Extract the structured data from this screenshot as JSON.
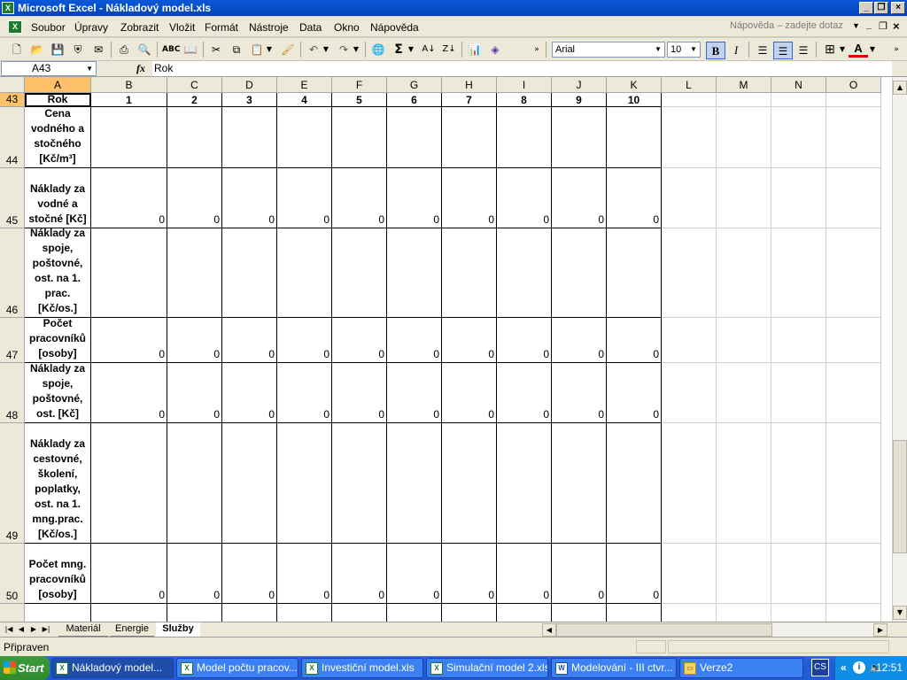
{
  "window": {
    "title": "Microsoft Excel - Nákladový model.xls"
  },
  "menu": {
    "items": [
      "Soubor",
      "Úpravy",
      "Zobrazit",
      "Vložit",
      "Formát",
      "Nástroje",
      "Data",
      "Okno",
      "Nápověda"
    ],
    "help_placeholder": "Nápověda – zadejte dotaz"
  },
  "toolbar": {
    "font_name": "Arial",
    "font_size": "10",
    "sigma": "Σ"
  },
  "formula_bar": {
    "cell_ref": "A43",
    "fx": "fx",
    "content": "Rok"
  },
  "columns": [
    "A",
    "B",
    "C",
    "D",
    "E",
    "F",
    "G",
    "H",
    "I",
    "J",
    "K",
    "L",
    "M",
    "N",
    "O"
  ],
  "rows": [
    {
      "num": "43",
      "label": "Rok",
      "values": [
        "1",
        "2",
        "3",
        "4",
        "5",
        "6",
        "7",
        "8",
        "9",
        "10"
      ]
    },
    {
      "num": "44",
      "label": "Cena vodného a stočného [Kč/m³]",
      "values": [
        "",
        "",
        "",
        "",
        "",
        "",
        "",
        "",
        "",
        ""
      ]
    },
    {
      "num": "45",
      "label": "Náklady za vodné a stočné [Kč]",
      "values": [
        "0",
        "0",
        "0",
        "0",
        "0",
        "0",
        "0",
        "0",
        "0",
        "0"
      ]
    },
    {
      "num": "46",
      "label": "Náklady za spoje, poštovné, ost. na 1. prac. [Kč/os.]",
      "values": [
        "",
        "",
        "",
        "",
        "",
        "",
        "",
        "",
        "",
        ""
      ]
    },
    {
      "num": "47",
      "label": "Počet pracovníků [osoby]",
      "values": [
        "0",
        "0",
        "0",
        "0",
        "0",
        "0",
        "0",
        "0",
        "0",
        "0"
      ]
    },
    {
      "num": "48",
      "label": "Náklady za spoje, poštovné, ost. [Kč]",
      "values": [
        "0",
        "0",
        "0",
        "0",
        "0",
        "0",
        "0",
        "0",
        "0",
        "0"
      ]
    },
    {
      "num": "49",
      "label": "Náklady za cestovné, školení, poplatky, ost. na 1. mng.prac. [Kč/os.]",
      "values": [
        "",
        "",
        "",
        "",
        "",
        "",
        "",
        "",
        "",
        ""
      ]
    },
    {
      "num": "50",
      "label": "Počet mng. pracovníků [osoby]",
      "values": [
        "0",
        "0",
        "0",
        "0",
        "0",
        "0",
        "0",
        "0",
        "0",
        "0"
      ]
    }
  ],
  "sheets": {
    "tabs": [
      "Materiál",
      "Energie",
      "Služby"
    ],
    "active": "Služby"
  },
  "status": {
    "text": "Připraven"
  },
  "taskbar": {
    "start": "Start",
    "tasks": [
      "Nákladový model...",
      "Model počtu pracov...",
      "Investiční model.xls",
      "Simulační model 2.xls",
      "Modelování - III ctvr...",
      "Verze2"
    ],
    "lang": "CS",
    "time": "12:51"
  }
}
